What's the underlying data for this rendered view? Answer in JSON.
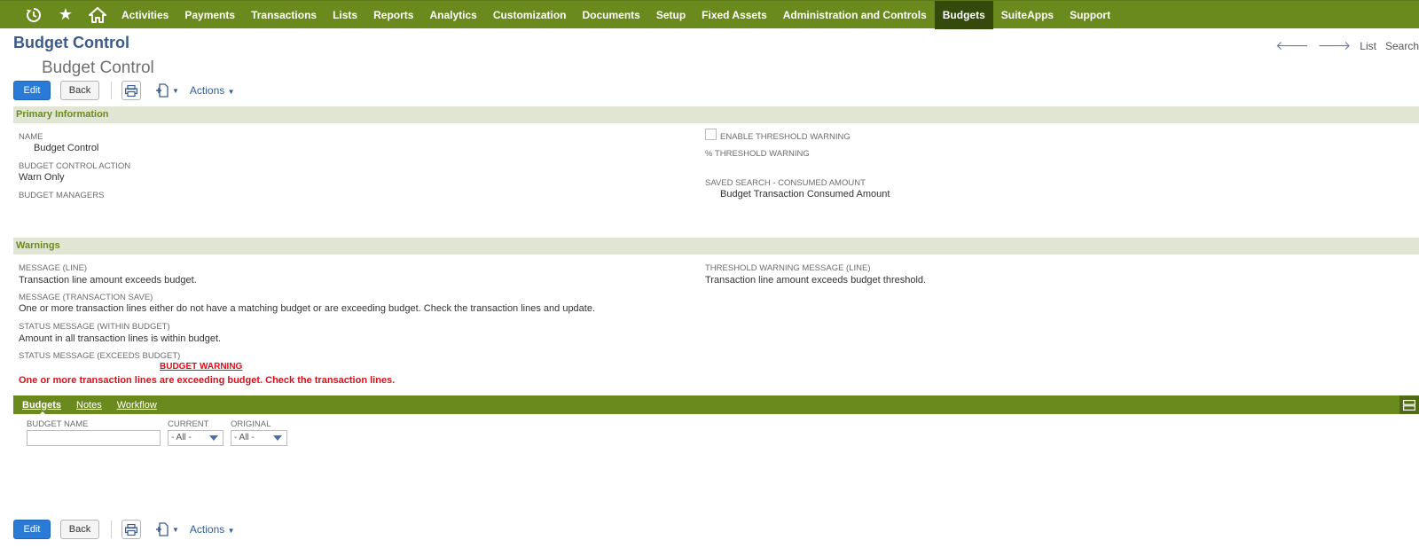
{
  "nav": {
    "icons": [
      "recent-records-icon",
      "star-icon",
      "home-icon"
    ],
    "items": [
      "Activities",
      "Payments",
      "Transactions",
      "Lists",
      "Reports",
      "Analytics",
      "Customization",
      "Documents",
      "Setup",
      "Fixed Assets",
      "Administration and Controls",
      "Budgets",
      "SuiteApps",
      "Support"
    ],
    "active": "Budgets"
  },
  "page": {
    "title": "Budget Control",
    "record_name": "Budget Control",
    "right_links": {
      "list": "List",
      "search": "Search"
    }
  },
  "toolbar": {
    "edit": "Edit",
    "back": "Back",
    "actions": "Actions"
  },
  "primary": {
    "header": "Primary Information",
    "name_label": "NAME",
    "name_value": "Budget Control",
    "action_label": "BUDGET CONTROL ACTION",
    "action_value": "Warn Only",
    "managers_label": "BUDGET MANAGERS",
    "threshold_enable_label": "ENABLE THRESHOLD WARNING",
    "threshold_pct_label": "% THRESHOLD WARNING",
    "saved_search_label": "SAVED SEARCH - CONSUMED AMOUNT",
    "saved_search_value": "Budget Transaction Consumed Amount"
  },
  "warnings": {
    "header": "Warnings",
    "msg_line_label": "MESSAGE (LINE)",
    "msg_line_value": "Transaction line amount exceeds budget.",
    "msg_save_label": "MESSAGE (TRANSACTION SAVE)",
    "msg_save_value": "One or more transaction lines either do not have a matching budget or are exceeding budget. Check the transaction lines and update.",
    "status_within_label": "STATUS MESSAGE (WITHIN BUDGET)",
    "status_within_value": "Amount in all transaction lines is within budget.",
    "status_exceeds_label": "STATUS MESSAGE (EXCEEDS BUDGET)",
    "status_exceeds_title": "BUDGET WARNING",
    "status_exceeds_value": "One or more transaction lines are exceeding budget. Check the transaction lines.",
    "threshold_msg_label": "THRESHOLD WARNING MESSAGE (LINE)",
    "threshold_msg_value": "Transaction line amount exceeds budget threshold."
  },
  "subtabs": {
    "tabs": [
      "Budgets",
      "Notes",
      "Workflow"
    ],
    "active": "Budgets",
    "filters": {
      "budget_name_label": "BUDGET NAME",
      "current_label": "CURRENT",
      "current_value": "- All -",
      "original_label": "ORIGINAL",
      "original_value": "- All -"
    }
  },
  "colors": {
    "nav_bg": "#6b8a1e",
    "nav_active": "#334a0c",
    "section_bg": "#e1e5d4",
    "title": "#3b5c8a",
    "warning_red": "#d4121b",
    "edit_button": "#2a7bd6"
  }
}
